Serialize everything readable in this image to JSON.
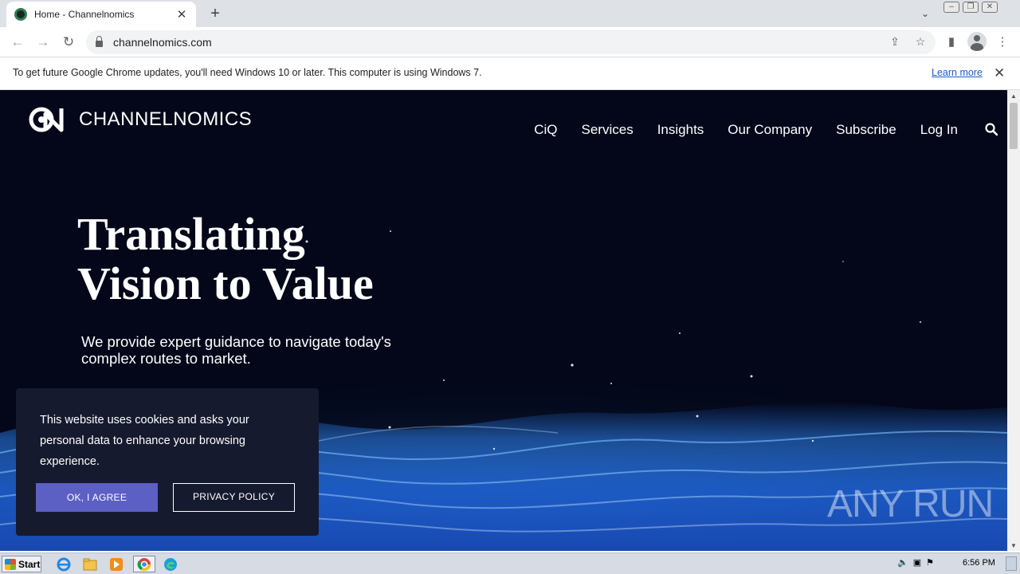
{
  "browser": {
    "tab_title": "Home - Channelnomics",
    "url": "channelnomics.com"
  },
  "infobar": {
    "message": "To get future Google Chrome updates, you'll need Windows 10 or later. This computer is using Windows 7.",
    "link": "Learn more"
  },
  "site": {
    "logo_text": "CHANNELNOMICS",
    "nav": [
      "CiQ",
      "Services",
      "Insights",
      "Our Company",
      "Subscribe",
      "Log In"
    ],
    "hero_line1": "Translating",
    "hero_line2": "Vision to Value",
    "hero_sub": "We provide expert guidance to navigate today's complex routes to market."
  },
  "cookie": {
    "text": "This website uses cookies and asks your personal data to enhance your browsing experience.",
    "agree": "OK, I AGREE",
    "policy": "PRIVACY POLICY"
  },
  "watermark": "ANY RUN",
  "taskbar": {
    "start": "Start",
    "time": "6:56 PM"
  },
  "colors": {
    "page_bg": "#030719",
    "accent": "#5c5fc4",
    "wave": "#1f6fe0"
  }
}
